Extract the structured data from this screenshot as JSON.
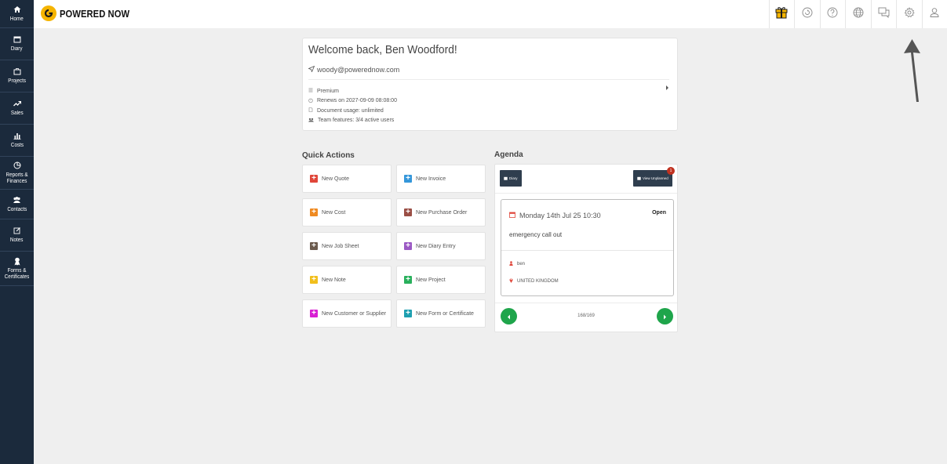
{
  "sidebar": {
    "items": [
      {
        "label": "Home",
        "icon": "home-icon"
      },
      {
        "label": "Diary",
        "icon": "calendar-icon"
      },
      {
        "label": "Projects",
        "icon": "briefcase-icon"
      },
      {
        "label": "Sales",
        "icon": "trend-up-icon"
      },
      {
        "label": "Costs",
        "icon": "bar-chart-icon"
      },
      {
        "label": "Reports &\nFinances",
        "icon": "pie-chart-icon"
      },
      {
        "label": "Contacts",
        "icon": "users-icon"
      },
      {
        "label": "Notes",
        "icon": "edit-icon"
      },
      {
        "label": "Forms &\nCertificates",
        "icon": "certificate-icon"
      }
    ]
  },
  "brand": {
    "name": "POWERED NOW"
  },
  "topbar": {
    "icons": [
      "gift-icon",
      "refresh-icon",
      "help-icon",
      "globe-icon",
      "chat-icon",
      "settings-icon",
      "user-icon"
    ]
  },
  "welcome": {
    "title": "Welcome back, Ben Woodford!",
    "email": "woody@powerednow.com",
    "plan": "Premium",
    "renews": "Renews on 2027-09-09 08:08:00",
    "document_usage": "Document usage: unlimited",
    "team_features": "Team features: 3/4 active users"
  },
  "quick_actions": {
    "title": "Quick Actions",
    "buttons": [
      {
        "label": "New Quote",
        "color": "#e0463a"
      },
      {
        "label": "New Invoice",
        "color": "#3597da"
      },
      {
        "label": "New Cost",
        "color": "#ef8a21"
      },
      {
        "label": "New Purchase Order",
        "color": "#9a4e45"
      },
      {
        "label": "New Job Sheet",
        "color": "#6b5a4d"
      },
      {
        "label": "New Diary Entry",
        "color": "#9b59c4"
      },
      {
        "label": "New Note",
        "color": "#f1bf1c"
      },
      {
        "label": "New Project",
        "color": "#29b05c"
      },
      {
        "label": "New Customer or Supplier",
        "color": "#d81fd3"
      },
      {
        "label": "New Form or Certificate",
        "color": "#1e9fb0"
      }
    ]
  },
  "agenda": {
    "title": "Agenda",
    "diary_button": "Diary",
    "view_unplanned_button": "View Unplanned",
    "badge_count": "1",
    "event": {
      "date": "Monday 14th Jul 25 10:30",
      "status": "Open",
      "title": "emergency call out",
      "person": "ben",
      "location": "UNITED KINGDOM"
    },
    "page": "168/169"
  },
  "colors": {
    "sidebar_bg": "#1b2a3c",
    "accent_yellow": "#f5b400",
    "nav_green": "#1fa54b",
    "agenda_button": "#2f3e4e",
    "badge_red": "#c0311f"
  }
}
